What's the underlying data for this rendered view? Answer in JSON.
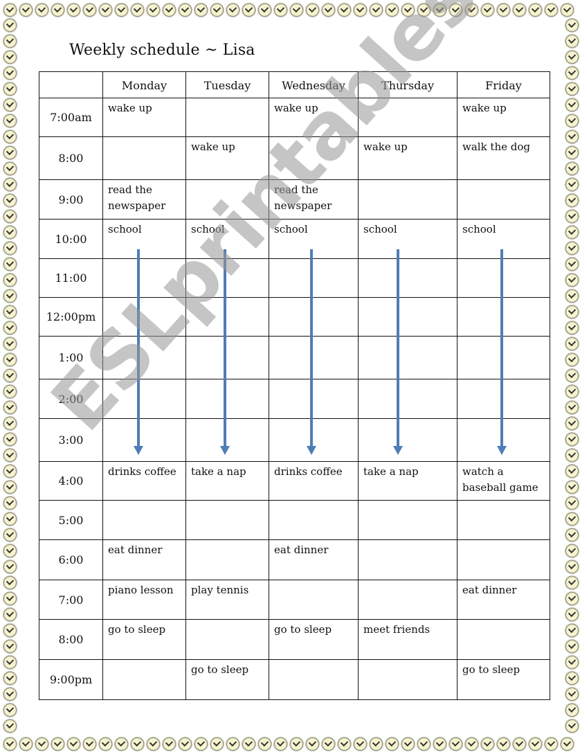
{
  "document": {
    "title": "Weekly schedule ~ Lisa",
    "watermark": "ESLprintables.com",
    "border_icon": "clock-icon",
    "arrow_color": "#4f7db5"
  },
  "table": {
    "columns": [
      "",
      "Monday",
      "Tuesday",
      "Wednesday",
      "Thursday",
      "Friday"
    ],
    "rows": [
      {
        "time": "7:00am",
        "cells": [
          "wake up",
          "",
          "wake up",
          "",
          "wake up"
        ]
      },
      {
        "time": "8:00",
        "cells": [
          "",
          "wake up",
          "",
          "wake up",
          "walk the dog"
        ]
      },
      {
        "time": "9:00",
        "cells": [
          "read the newspaper",
          "",
          "read the newspaper",
          "",
          ""
        ]
      },
      {
        "time": "10:00",
        "cells": [
          "school",
          "school",
          "school",
          "school",
          "school"
        ]
      },
      {
        "time": "11:00",
        "cells": [
          "",
          "",
          "",
          "",
          ""
        ]
      },
      {
        "time": "12:00pm",
        "cells": [
          "",
          "",
          "",
          "",
          ""
        ]
      },
      {
        "time": "1:00",
        "cells": [
          "",
          "",
          "",
          "",
          ""
        ]
      },
      {
        "time": "2:00",
        "cells": [
          "",
          "",
          "",
          "",
          ""
        ]
      },
      {
        "time": "3:00",
        "cells": [
          "",
          "",
          "",
          "",
          ""
        ]
      },
      {
        "time": "4:00",
        "cells": [
          "drinks coffee",
          "take a nap",
          "drinks coffee",
          "take a nap",
          "watch a baseball game"
        ]
      },
      {
        "time": "5:00",
        "cells": [
          "",
          "",
          "",
          "",
          ""
        ]
      },
      {
        "time": "6:00",
        "cells": [
          "eat dinner",
          "",
          "eat dinner",
          "",
          ""
        ]
      },
      {
        "time": "7:00",
        "cells": [
          "piano lesson",
          "play tennis",
          "",
          "",
          "eat dinner"
        ]
      },
      {
        "time": "8:00",
        "cells": [
          "go to sleep",
          "",
          "go to sleep",
          "meet friends",
          ""
        ]
      },
      {
        "time": "9:00pm",
        "cells": [
          "",
          "go to sleep",
          "",
          "",
          "go to sleep"
        ]
      }
    ]
  }
}
